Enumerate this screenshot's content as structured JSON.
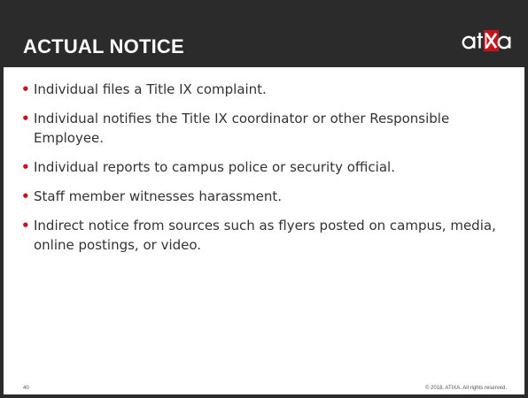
{
  "header": {
    "title": "ACTUAL NOTICE",
    "logo": {
      "text": "atixa",
      "accent_color": "#c4151c"
    }
  },
  "bullets": [
    "Individual files a Title IX complaint.",
    "Individual notifies the Title IX coordinator or other Responsible Employee.",
    "Individual reports to campus police or security official.",
    "Staff member witnesses harassment.",
    "Indirect notice from sources such as flyers posted on campus, media, online postings, or video."
  ],
  "bullet_glyph": "•",
  "footer": {
    "page_number": "40",
    "copyright": "© 2018, ATIXA. All rights reserved."
  },
  "colors": {
    "header_bg": "#2b2b2b",
    "accent": "#c4151c",
    "text": "#333333"
  }
}
